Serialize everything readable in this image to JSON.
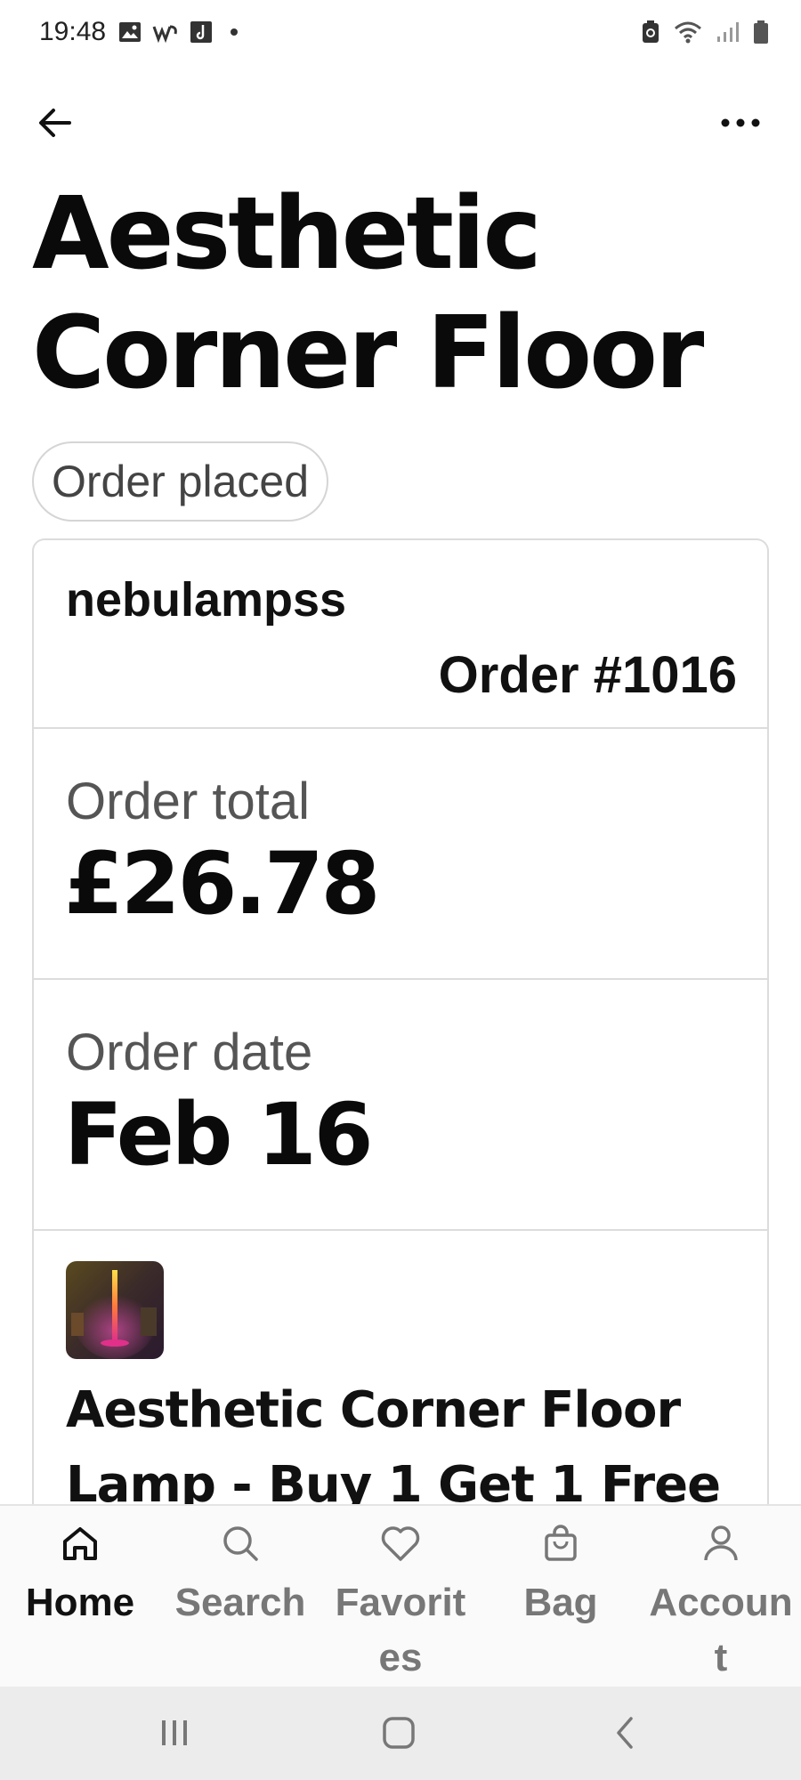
{
  "status_bar": {
    "time": "19:48"
  },
  "header": {
    "back_icon": "arrow-left-icon",
    "more_icon": "more-horizontal-icon"
  },
  "page": {
    "title": "Aesthetic\nCorner Floor L..",
    "status_pill": "Order placed"
  },
  "order": {
    "shop_name": "nebulampss",
    "order_number": "Order #1016",
    "total_label": "Order total",
    "total_value": "£26.78",
    "date_label": "Order date",
    "date_value": "Feb 16",
    "item_title": "Aesthetic Corner Floor Lamp - Buy 1 Get 1 Free"
  },
  "bottom_nav": {
    "items": [
      {
        "label": "Home",
        "icon": "home-icon",
        "active": true
      },
      {
        "label": "Search",
        "icon": "search-icon",
        "active": false
      },
      {
        "label": "Favorites",
        "icon": "heart-icon",
        "active": false
      },
      {
        "label": "Bag",
        "icon": "bag-icon",
        "active": false
      },
      {
        "label": "Account",
        "icon": "account-icon",
        "active": false
      }
    ]
  },
  "colors": {
    "active_nav": "#111111",
    "inactive_nav": "#777777",
    "border": "#dcdcdc",
    "system_nav_bg": "#ececec"
  }
}
